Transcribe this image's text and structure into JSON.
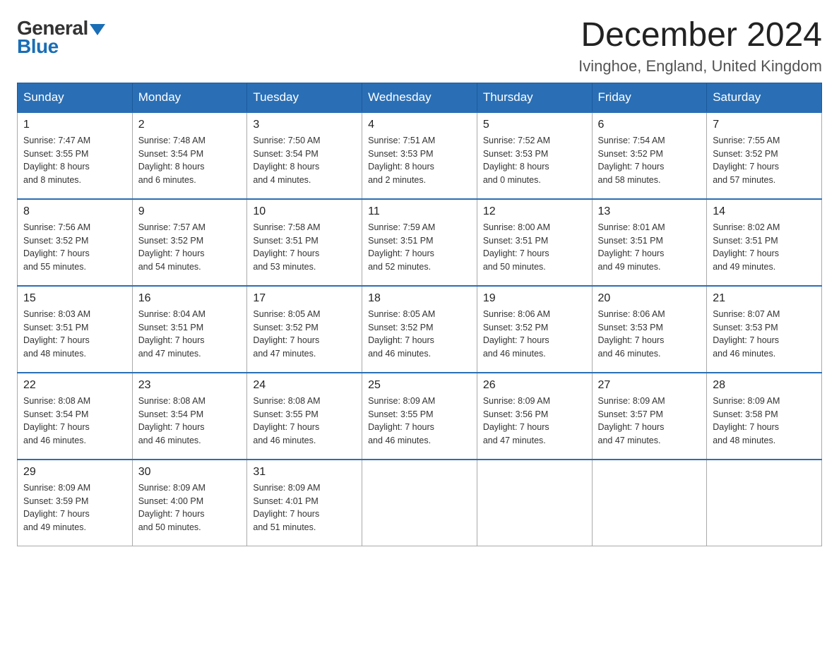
{
  "logo": {
    "general": "General",
    "blue": "Blue"
  },
  "title": "December 2024",
  "subtitle": "Ivinghoe, England, United Kingdom",
  "days_of_week": [
    "Sunday",
    "Monday",
    "Tuesday",
    "Wednesday",
    "Thursday",
    "Friday",
    "Saturday"
  ],
  "weeks": [
    [
      {
        "day": "1",
        "sunrise": "7:47 AM",
        "sunset": "3:55 PM",
        "daylight": "8 hours and 8 minutes."
      },
      {
        "day": "2",
        "sunrise": "7:48 AM",
        "sunset": "3:54 PM",
        "daylight": "8 hours and 6 minutes."
      },
      {
        "day": "3",
        "sunrise": "7:50 AM",
        "sunset": "3:54 PM",
        "daylight": "8 hours and 4 minutes."
      },
      {
        "day": "4",
        "sunrise": "7:51 AM",
        "sunset": "3:53 PM",
        "daylight": "8 hours and 2 minutes."
      },
      {
        "day": "5",
        "sunrise": "7:52 AM",
        "sunset": "3:53 PM",
        "daylight": "8 hours and 0 minutes."
      },
      {
        "day": "6",
        "sunrise": "7:54 AM",
        "sunset": "3:52 PM",
        "daylight": "7 hours and 58 minutes."
      },
      {
        "day": "7",
        "sunrise": "7:55 AM",
        "sunset": "3:52 PM",
        "daylight": "7 hours and 57 minutes."
      }
    ],
    [
      {
        "day": "8",
        "sunrise": "7:56 AM",
        "sunset": "3:52 PM",
        "daylight": "7 hours and 55 minutes."
      },
      {
        "day": "9",
        "sunrise": "7:57 AM",
        "sunset": "3:52 PM",
        "daylight": "7 hours and 54 minutes."
      },
      {
        "day": "10",
        "sunrise": "7:58 AM",
        "sunset": "3:51 PM",
        "daylight": "7 hours and 53 minutes."
      },
      {
        "day": "11",
        "sunrise": "7:59 AM",
        "sunset": "3:51 PM",
        "daylight": "7 hours and 52 minutes."
      },
      {
        "day": "12",
        "sunrise": "8:00 AM",
        "sunset": "3:51 PM",
        "daylight": "7 hours and 50 minutes."
      },
      {
        "day": "13",
        "sunrise": "8:01 AM",
        "sunset": "3:51 PM",
        "daylight": "7 hours and 49 minutes."
      },
      {
        "day": "14",
        "sunrise": "8:02 AM",
        "sunset": "3:51 PM",
        "daylight": "7 hours and 49 minutes."
      }
    ],
    [
      {
        "day": "15",
        "sunrise": "8:03 AM",
        "sunset": "3:51 PM",
        "daylight": "7 hours and 48 minutes."
      },
      {
        "day": "16",
        "sunrise": "8:04 AM",
        "sunset": "3:51 PM",
        "daylight": "7 hours and 47 minutes."
      },
      {
        "day": "17",
        "sunrise": "8:05 AM",
        "sunset": "3:52 PM",
        "daylight": "7 hours and 47 minutes."
      },
      {
        "day": "18",
        "sunrise": "8:05 AM",
        "sunset": "3:52 PM",
        "daylight": "7 hours and 46 minutes."
      },
      {
        "day": "19",
        "sunrise": "8:06 AM",
        "sunset": "3:52 PM",
        "daylight": "7 hours and 46 minutes."
      },
      {
        "day": "20",
        "sunrise": "8:06 AM",
        "sunset": "3:53 PM",
        "daylight": "7 hours and 46 minutes."
      },
      {
        "day": "21",
        "sunrise": "8:07 AM",
        "sunset": "3:53 PM",
        "daylight": "7 hours and 46 minutes."
      }
    ],
    [
      {
        "day": "22",
        "sunrise": "8:08 AM",
        "sunset": "3:54 PM",
        "daylight": "7 hours and 46 minutes."
      },
      {
        "day": "23",
        "sunrise": "8:08 AM",
        "sunset": "3:54 PM",
        "daylight": "7 hours and 46 minutes."
      },
      {
        "day": "24",
        "sunrise": "8:08 AM",
        "sunset": "3:55 PM",
        "daylight": "7 hours and 46 minutes."
      },
      {
        "day": "25",
        "sunrise": "8:09 AM",
        "sunset": "3:55 PM",
        "daylight": "7 hours and 46 minutes."
      },
      {
        "day": "26",
        "sunrise": "8:09 AM",
        "sunset": "3:56 PM",
        "daylight": "7 hours and 47 minutes."
      },
      {
        "day": "27",
        "sunrise": "8:09 AM",
        "sunset": "3:57 PM",
        "daylight": "7 hours and 47 minutes."
      },
      {
        "day": "28",
        "sunrise": "8:09 AM",
        "sunset": "3:58 PM",
        "daylight": "7 hours and 48 minutes."
      }
    ],
    [
      {
        "day": "29",
        "sunrise": "8:09 AM",
        "sunset": "3:59 PM",
        "daylight": "7 hours and 49 minutes."
      },
      {
        "day": "30",
        "sunrise": "8:09 AM",
        "sunset": "4:00 PM",
        "daylight": "7 hours and 50 minutes."
      },
      {
        "day": "31",
        "sunrise": "8:09 AM",
        "sunset": "4:01 PM",
        "daylight": "7 hours and 51 minutes."
      },
      null,
      null,
      null,
      null
    ]
  ],
  "labels": {
    "sunrise": "Sunrise:",
    "sunset": "Sunset:",
    "daylight": "Daylight:"
  }
}
